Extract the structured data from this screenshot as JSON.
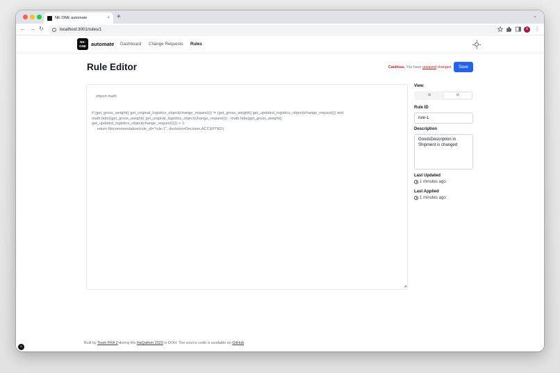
{
  "browser": {
    "tab_title": "NE:ONE automate",
    "tab_close": "×",
    "new_tab": "+",
    "tabs_menu": "⌄",
    "back": "←",
    "forward": "→",
    "reload": "↻",
    "url": "localhost:3001/rules/1",
    "profile_initial": "U",
    "menu": "⋮"
  },
  "header": {
    "logo_top": "NE:",
    "logo_bottom": "ONE",
    "brand": "automate",
    "nav": [
      "Dashboard",
      "Change Requests",
      "Rules"
    ],
    "active_nav": "Rules"
  },
  "page": {
    "title": "Rule Editor",
    "caution_label": "Cautious.",
    "caution_pre": " You have ",
    "caution_unsaved": "unsaved",
    "caution_post": " changes.",
    "save_label": "Save"
  },
  "editor": {
    "code": "import math\n\n\nif (get_gross_weight(( get_original_logistics_object(change_request))) != (get_gross_weight(( get_updated_logistics_object(change_request))) and\nmath.fabs((get_gross_weight(( get_original_logistics_object(change_request))) - math.fabs(get_gross_weight((\nget_updated_logistics_object(change_request))))) < 1:\n     return Recommendation(rule_id=\"rule-1\", decision=Decision.ACCEPTED)"
  },
  "sidebar": {
    "view_label": "View",
    "view_options": [
      "⊞",
      "‹/›"
    ],
    "active_view": "code",
    "rule_id_label": "Rule ID",
    "rule_id_value": "rule-1",
    "description_label": "Description",
    "description_value": "GoodsDescription in Shipment is changed",
    "last_updated_label": "Last Updated",
    "last_updated_value": "1 minutes ago",
    "last_applied_label": "Last Applied",
    "last_applied_value": "1 minutes ago"
  },
  "footer": {
    "pre": "Built by ",
    "team": "Team FRA 2",
    "mid": " during the ",
    "event": "HaQathon 2023",
    "post": " in DOH. The source code is available on ",
    "repo": "GitHub",
    "end": "."
  },
  "corner_badge": "N",
  "colors": {
    "primary": "#2563eb",
    "caution": "#b91c1c",
    "text": "#111827",
    "muted": "#6b7280"
  }
}
